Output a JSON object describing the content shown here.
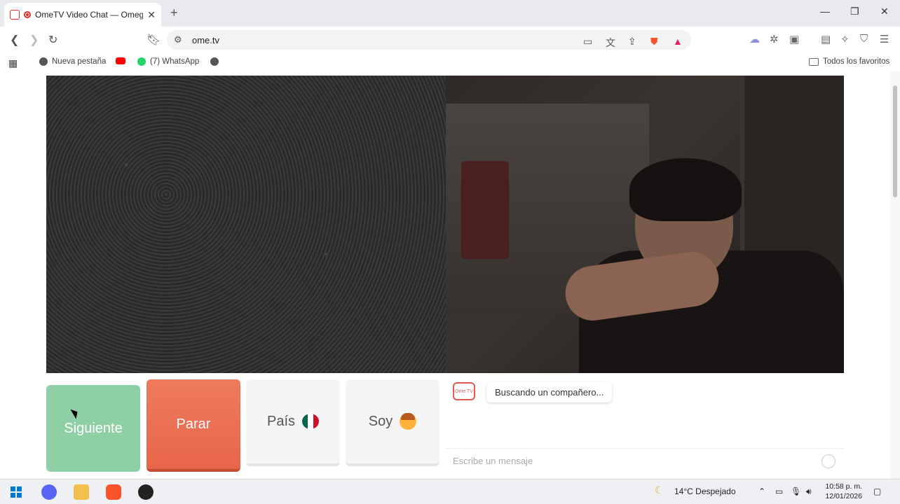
{
  "browser": {
    "tab_title": "OmeTV Video Chat — Omeg",
    "url": "ome.tv",
    "new_tab_symbol": "+",
    "bookmarks": [
      {
        "label": "Nueva pestaña"
      },
      {
        "label": ""
      },
      {
        "label": "(7) WhatsApp"
      },
      {
        "label": ""
      }
    ],
    "all_bookmarks_label": "Todos los favoritos",
    "colors": {
      "tab_strip": "#e8eaed",
      "omnibox": "#f1f3f4",
      "brave_orange": "#fb542b"
    }
  },
  "page": {
    "buttons": {
      "next": "Siguiente",
      "stop": "Parar",
      "country": "País",
      "gender": "Soy"
    },
    "chat": {
      "logo_text": "Ome TV",
      "status_message": "Buscando un compañero...",
      "input_placeholder": "Escribe un mensaje"
    },
    "colors": {
      "next": "#8fcfa5",
      "stop": "#e8664a",
      "neutral": "#f5f5f5"
    }
  },
  "taskbar": {
    "weather": "14°C  Despejado",
    "time": "10:58 p. m.",
    "date": "12/01/2026"
  }
}
